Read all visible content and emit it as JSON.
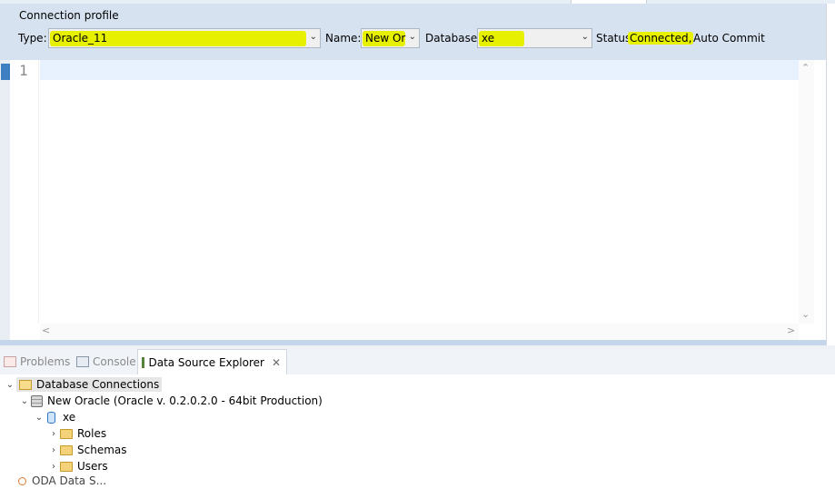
{
  "connection_profile": {
    "title": "Connection profile",
    "type_label": "Type:",
    "type_value": "Oracle_11",
    "name_label": "Name:",
    "name_value": "New Or",
    "database_label": "Database:",
    "database_value": "xe",
    "status_label": "Status:",
    "status_value": "Connected,",
    "status_extra": "Auto Commit",
    "highlight_color": "#e6f000"
  },
  "editor": {
    "line_number": "1"
  },
  "bottom_tabs": [
    {
      "label": "Problems",
      "active": false
    },
    {
      "label": "Console",
      "active": false
    },
    {
      "label": "Data Source Explorer",
      "active": true
    }
  ],
  "tree": {
    "root": "Database Connections",
    "connection": "New Oracle (Oracle v. 0.2.0.2.0 - 64bit Production)",
    "database": "xe",
    "children": [
      "Roles",
      "Schemas",
      "Users"
    ],
    "partial_next": "ODA Data S..."
  }
}
